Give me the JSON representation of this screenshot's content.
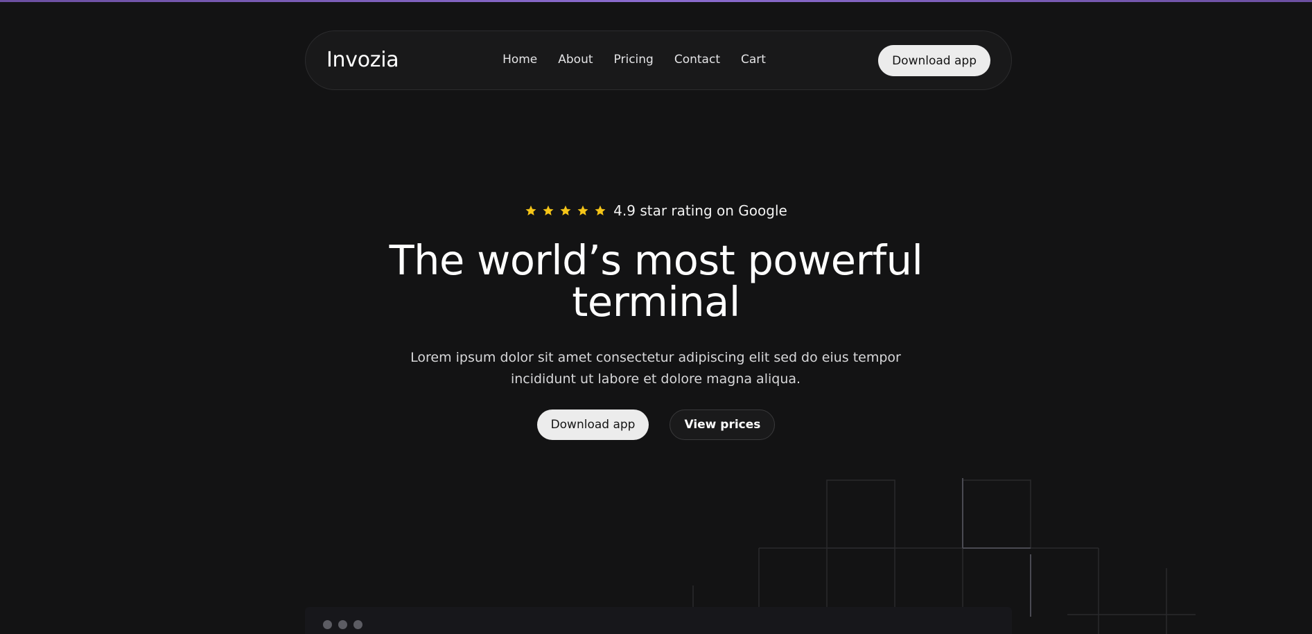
{
  "nav": {
    "brand": "Invozia",
    "links": [
      "Home",
      "About",
      "Pricing",
      "Contact",
      "Cart"
    ],
    "cta": "Download app"
  },
  "hero": {
    "rating_value": 5,
    "rating_max": 5,
    "rating_text": "4.9 star rating on Google",
    "headline_line1": "The world’s most powerful",
    "headline_line2": "terminal",
    "subtext_line1": "Lorem ipsum dolor sit amet consectetur adipiscing elit sed do eius tempor",
    "subtext_line2": "incididunt ut labore et dolore magna aliqua.",
    "primary_button": "Download app",
    "secondary_button": "View prices"
  },
  "colors": {
    "background": "#131314",
    "accent_bar": "#8b6ccf",
    "star": "#f5c518",
    "button_light": "#ececec"
  },
  "icons": [
    "star-icon",
    "window-dot-icon"
  ]
}
